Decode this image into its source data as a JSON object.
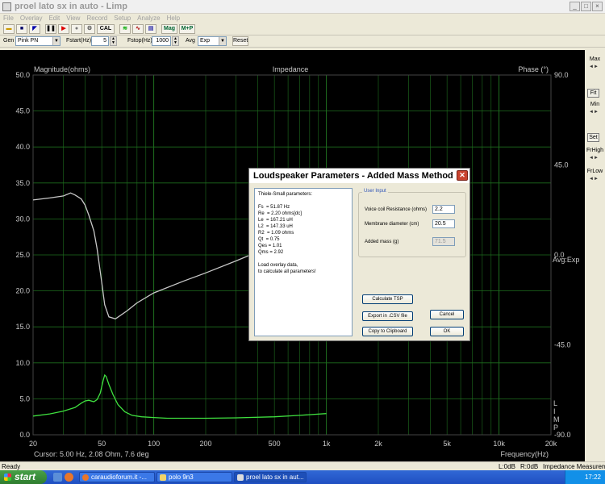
{
  "window": {
    "title": "proel lato sx in auto - Limp",
    "buttons": [
      "_",
      "□",
      "×"
    ]
  },
  "menu": [
    "File",
    "Overlay",
    "Edit",
    "View",
    "Record",
    "Setup",
    "Analyze",
    "Help"
  ],
  "toolbar": {
    "cal": "CAL",
    "mag": "Mag",
    "mp": "M+P"
  },
  "params": {
    "gen_label": "Gen",
    "gen_value": "Pink PN",
    "fstart_label": "Fstart(Hz)",
    "fstart_value": "5",
    "fstop_label": "Fstop(Hz)",
    "fstop_value": "1000",
    "avg_label": "Avg",
    "avg_value": "Exp",
    "reset": "Reset"
  },
  "chart_data": {
    "type": "line",
    "title": "Impedance",
    "ylabel": "Magnitude(ohms)",
    "y2label": "Phase (°)",
    "xlabel": "Frequency(Hz)",
    "xscale": "log",
    "xlim": [
      20,
      20000
    ],
    "ylim": [
      0,
      50
    ],
    "y2lim": [
      -90,
      90
    ],
    "x_ticks": [
      "20",
      "50",
      "100",
      "200",
      "500",
      "1k",
      "2k",
      "5k",
      "10k",
      "20k"
    ],
    "x_tick_values": [
      20,
      50,
      100,
      200,
      500,
      1000,
      2000,
      5000,
      10000,
      20000
    ],
    "y_ticks": [
      "0.0",
      "5.0",
      "10.0",
      "15.0",
      "20.0",
      "25.0",
      "30.0",
      "35.0",
      "40.0",
      "45.0",
      "50.0"
    ],
    "y_tick_values": [
      0,
      5,
      10,
      15,
      20,
      25,
      30,
      35,
      40,
      45,
      50
    ],
    "y2_ticks": [
      "90.0",
      "45.0",
      "0.0",
      "-45.0",
      "-90.0"
    ],
    "y2_tick_values": [
      90,
      45,
      0,
      -45,
      -90
    ],
    "avg_note": "Avg:Exp",
    "limp_label": [
      "L",
      "I",
      "M",
      "P"
    ],
    "colors": {
      "magnitude": "#3fe03f",
      "phase": "#c8c8c8",
      "grid": "#1e6e1e",
      "background": "#000000"
    },
    "series": [
      {
        "values": [
          [
            20,
            2.6
          ],
          [
            25,
            2.9
          ],
          [
            30,
            3.3
          ],
          [
            35,
            3.8
          ],
          [
            38,
            4.4
          ],
          [
            40,
            4.7
          ],
          [
            42,
            4.8
          ],
          [
            45,
            4.6
          ],
          [
            47,
            4.9
          ],
          [
            49,
            5.8
          ],
          [
            51,
            7.6
          ],
          [
            52,
            8.3
          ],
          [
            53,
            8.1
          ],
          [
            55,
            7.0
          ],
          [
            58,
            5.6
          ],
          [
            62,
            4.2
          ],
          [
            68,
            3.2
          ],
          [
            75,
            2.7
          ],
          [
            85,
            2.5
          ],
          [
            100,
            2.4
          ],
          [
            120,
            2.3
          ],
          [
            150,
            2.3
          ],
          [
            200,
            2.3
          ],
          [
            300,
            2.35
          ],
          [
            500,
            2.5
          ],
          [
            700,
            2.7
          ],
          [
            1000,
            2.95
          ]
        ]
      },
      {
        "values": [
          [
            20,
            27.5
          ],
          [
            25,
            28.5
          ],
          [
            30,
            29.5
          ],
          [
            33,
            31
          ],
          [
            35,
            30
          ],
          [
            38,
            28
          ],
          [
            40,
            25
          ],
          [
            42,
            20
          ],
          [
            45,
            12
          ],
          [
            47,
            3
          ],
          [
            50,
            -14
          ],
          [
            52,
            -25
          ],
          [
            55,
            -31
          ],
          [
            60,
            -32
          ],
          [
            70,
            -28
          ],
          [
            80,
            -24
          ],
          [
            100,
            -19
          ],
          [
            150,
            -13
          ],
          [
            200,
            -9
          ],
          [
            300,
            -3
          ],
          [
            500,
            5
          ],
          [
            700,
            10
          ],
          [
            1000,
            14
          ]
        ]
      }
    ]
  },
  "right_panel": {
    "max": "Max",
    "fit": "Fit",
    "min": "Min",
    "set": "Set",
    "frhigh": "FrHigh",
    "frlow": "FrLow"
  },
  "status": {
    "ready": "Ready",
    "cursor": "Cursor: 5.00 Hz, 2.08 Ohm, 7.6 deg",
    "l": "L:0dB",
    "r": "R:0dB",
    "mode": "Impedance Measurement"
  },
  "dialog": {
    "title": "Loudspeaker Parameters - Added Mass Method",
    "ts_heading": "Thiele-Small parameters:",
    "ts_params": [
      "Fs  = 51.87 Hz",
      "Re  = 2.20 ohms[dc]",
      "Le  = 167.21 uH",
      "L2  = 147.33 uH",
      "R2  = 1.09 ohms",
      "Qt  = 0.75",
      "Qes = 1.01",
      "Qms = 2.92"
    ],
    "ts_note": "Load overlay data,\nto calculate all parameters!",
    "user_input_legend": "User Input",
    "voice_coil_label": "Voice coil Resistance (ohms)",
    "voice_coil_value": "2.2",
    "membrane_label": "Membrane diameter (cm)",
    "membrane_value": "20.5",
    "added_mass_label": "Added mass (g)",
    "added_mass_value": "71.5",
    "calculate": "Calculate TSP",
    "export": "Export in .CSV file",
    "copy": "Copy to Clipboard",
    "cancel": "Cancel",
    "ok": "OK"
  },
  "taskbar": {
    "start": "start",
    "tasks": [
      "caraudioforum.it -...",
      "polo 9n3",
      "proel lato sx in aut..."
    ],
    "clock": "17:22"
  }
}
